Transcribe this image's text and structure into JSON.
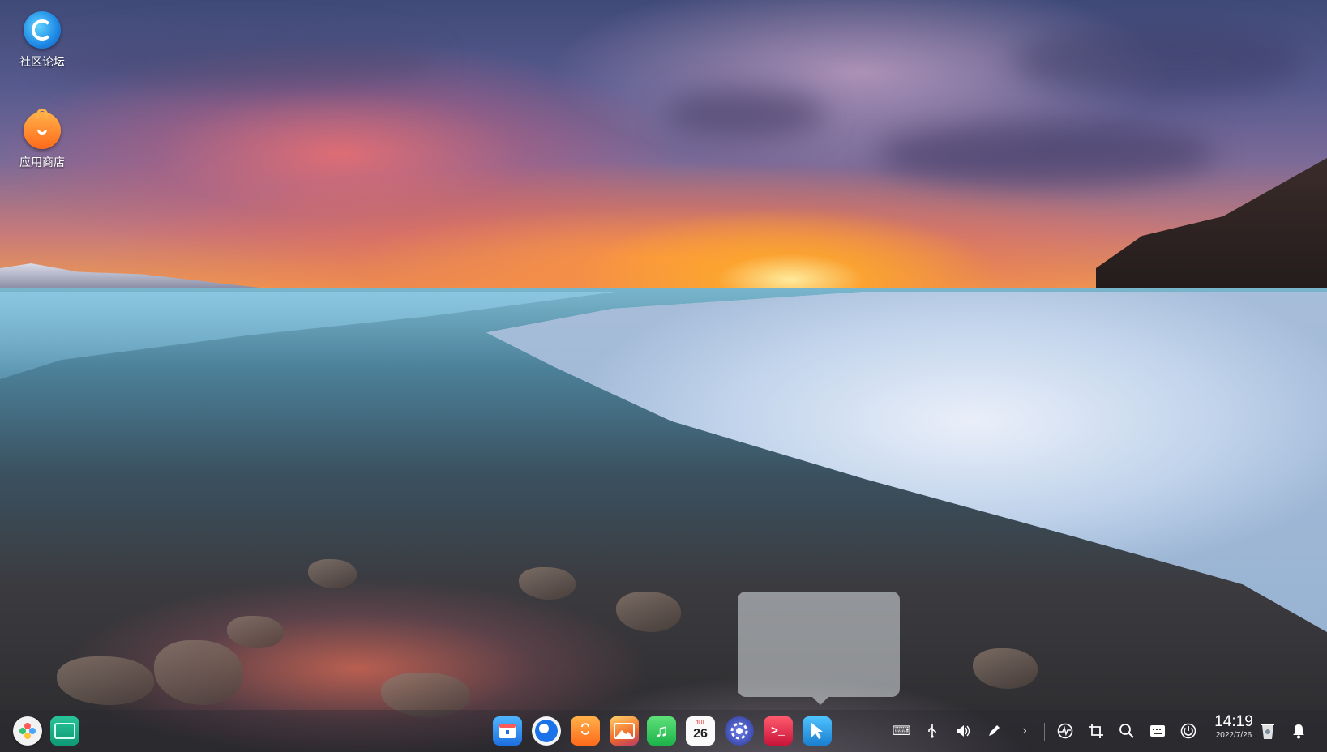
{
  "desktop": {
    "icons": [
      {
        "label": "社区论坛",
        "icon": "deepin-forum-icon"
      },
      {
        "label": "应用商店",
        "icon": "app-store-icon"
      }
    ]
  },
  "dock": {
    "apps": [
      {
        "name": "launcher",
        "icon": "launcher-icon"
      },
      {
        "name": "multitasking-view",
        "icon": "multitask-icon"
      },
      {
        "name": "file-manager",
        "icon": "file-manager-icon",
        "color": "#1e88e5"
      },
      {
        "name": "browser",
        "icon": "browser-icon",
        "color": "#1565c0"
      },
      {
        "name": "app-store",
        "icon": "app-store-icon",
        "color": "#ff7a1f"
      },
      {
        "name": "image-viewer",
        "icon": "photo-icon",
        "color": "#f08a30"
      },
      {
        "name": "music",
        "icon": "music-icon",
        "color": "#32c850"
      },
      {
        "name": "calendar",
        "icon": "calendar-icon",
        "month": "JUL",
        "day": "26"
      },
      {
        "name": "control-center",
        "icon": "settings-icon",
        "color": "#4a5ab8"
      },
      {
        "name": "terminal",
        "icon": "terminal-icon",
        "color": "#e0304a"
      },
      {
        "name": "screenshot-app",
        "icon": "cursor-icon",
        "color": "#2a9ae0"
      }
    ]
  },
  "tray": {
    "items": [
      {
        "name": "onboard-keyboard",
        "icon": "keyboard-icon"
      },
      {
        "name": "usb",
        "icon": "usb-icon"
      },
      {
        "name": "volume",
        "icon": "volume-icon"
      },
      {
        "name": "pen",
        "icon": "pen-icon"
      },
      {
        "name": "expand",
        "icon": "chevron-right-icon"
      },
      {
        "name": "system-monitor",
        "icon": "monitor-icon"
      },
      {
        "name": "screenshot",
        "icon": "crop-icon"
      },
      {
        "name": "search",
        "icon": "search-icon"
      },
      {
        "name": "keyboard-layout",
        "icon": "keyboard-layout-icon"
      },
      {
        "name": "power",
        "icon": "power-icon"
      }
    ],
    "clock": {
      "time": "14:19",
      "date": "2022/7/26"
    },
    "trash_icon": "trash-icon",
    "notification_icon": "bell-icon"
  }
}
